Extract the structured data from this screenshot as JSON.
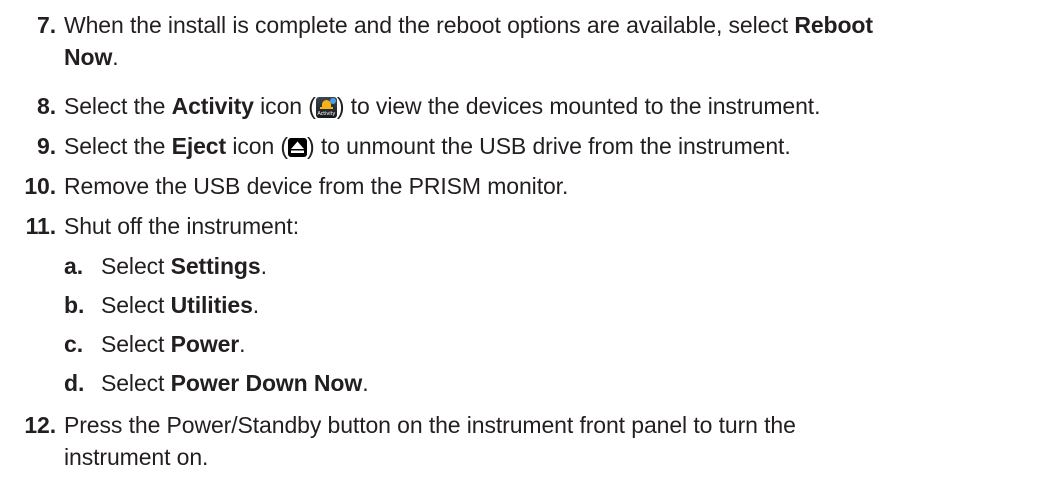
{
  "steps": [
    {
      "num": "7.",
      "text_a": "When the install is complete and the reboot options are available, select ",
      "bold_a": "Reboot",
      "line2_bold": "Now",
      "line2_rest": "."
    },
    {
      "num": "8.",
      "pre": "Select the ",
      "bold": "Activity",
      "mid": " icon (",
      "post": ") to view the devices mounted to the instrument.",
      "icon_caption": "Activity"
    },
    {
      "num": "9.",
      "pre": "Select the ",
      "bold": "Eject",
      "mid": " icon (",
      "post": ") to unmount the USB drive from the instrument."
    },
    {
      "num": "10.",
      "text": "Remove the USB device from the PRISM monitor."
    },
    {
      "num": "11.",
      "text": "Shut off the instrument:"
    },
    {
      "num": "12.",
      "line1": "Press the Power/Standby button on the instrument front panel to turn the",
      "line2": "instrument on."
    }
  ],
  "substeps": [
    {
      "num": "a.",
      "pre": "Select ",
      "bold": "Settings",
      "post": "."
    },
    {
      "num": "b.",
      "pre": "Select ",
      "bold": "Utilities",
      "post": "."
    },
    {
      "num": "c.",
      "pre": "Select ",
      "bold": "Power",
      "post": "."
    },
    {
      "num": "d.",
      "pre": "Select ",
      "bold": "Power Down Now",
      "post": "."
    }
  ],
  "icons": {
    "activity": "activity-bell-icon",
    "eject": "eject-icon"
  },
  "colors": {
    "text": "#231f20",
    "activity_bell": "#f5b31b"
  }
}
